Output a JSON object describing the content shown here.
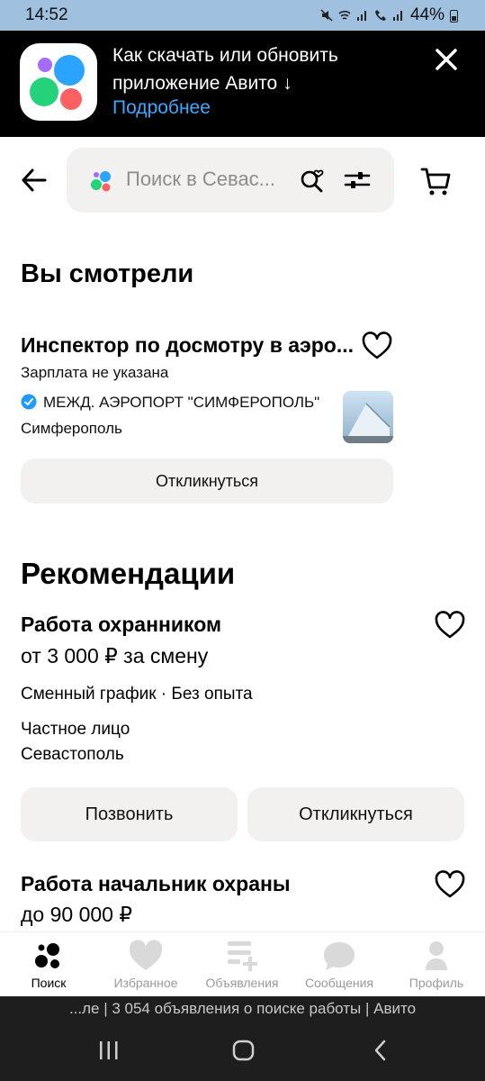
{
  "status": {
    "time": "14:52",
    "battery": "44%"
  },
  "banner": {
    "line1": "Как скачать или обновить",
    "line2": "приложение Авито ↓",
    "more": "Подробнее"
  },
  "search": {
    "placeholder": "Поиск в Севас..."
  },
  "viewed": {
    "heading": "Вы смотрели",
    "item": {
      "title": "Инспектор по досмотру в аэро...",
      "salary": "Зарплата не указана",
      "company": "МЕЖД. АЭРОПОРТ \"СИМФЕРОПОЛЬ\"",
      "city": "Симферополь",
      "respond": "Откликнуться"
    }
  },
  "recommendations": {
    "heading": "Рекомендации",
    "items": [
      {
        "title": "Работа охранником",
        "price": "от 3 000 ₽ за смену",
        "schedule": "Сменный график · Без опыта",
        "seller": "Частное лицо",
        "city": "Севастополь",
        "call": "Позвонить",
        "respond": "Откликнуться"
      },
      {
        "title": "Работа начальник охраны",
        "price": "до 90 000 ₽"
      }
    ]
  },
  "nav": [
    {
      "label": "Поиск"
    },
    {
      "label": "Избранное"
    },
    {
      "label": "Объявления"
    },
    {
      "label": "Сообщения"
    },
    {
      "label": "Профиль"
    }
  ],
  "system": {
    "caption": "...ле | 3 054 объявления о поиске работы | Авито"
  },
  "colors": {
    "accent": "#3ba9ff",
    "banner_bg": "#000000",
    "card_bg": "#f2f1f0",
    "verified": "#1f9bff"
  }
}
